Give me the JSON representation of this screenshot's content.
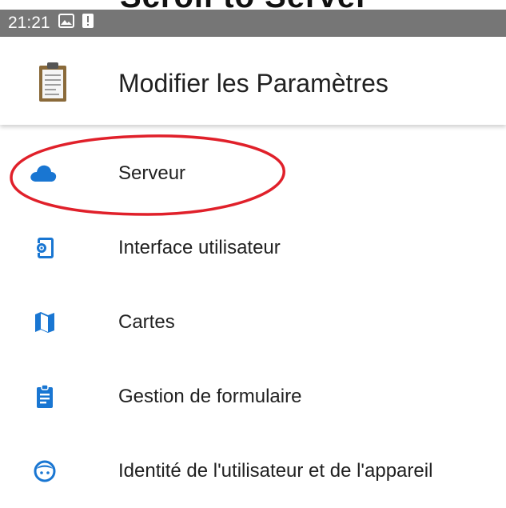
{
  "status_bar": {
    "time": "21:21",
    "icons": [
      "image-icon",
      "alert-icon"
    ]
  },
  "app_bar": {
    "title": "Modifier les Paramètres",
    "logo_icon": "clipboard-icon"
  },
  "settings_list": [
    {
      "label": "Serveur",
      "icon": "cloud-icon",
      "highlighted": true
    },
    {
      "label": "Interface utilisateur",
      "icon": "phone-settings-icon"
    },
    {
      "label": "Cartes",
      "icon": "map-icon"
    },
    {
      "label": "Gestion de formulaire",
      "icon": "assignment-icon"
    },
    {
      "label": "Identité de l'utilisateur et de l'appareil",
      "icon": "face-icon"
    }
  ],
  "colors": {
    "accent": "#1976D2",
    "status_bar": "#767676",
    "highlight": "#E0202A",
    "text": "#212121"
  }
}
